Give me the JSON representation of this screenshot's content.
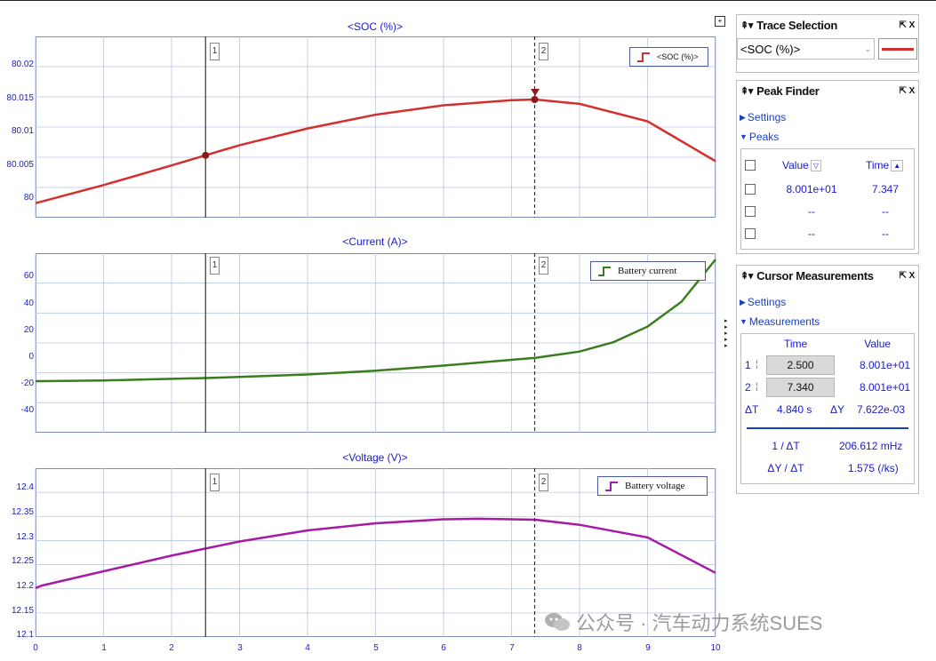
{
  "plots": [
    {
      "id": "soc",
      "title": "<SOC (%)>",
      "yticks": [
        "80.02",
        "80.015",
        "80.01",
        "80.005",
        "80"
      ],
      "legend": "<SOC (%)>",
      "color": "#d32f2f"
    },
    {
      "id": "current",
      "title": "<Current (A)>",
      "yticks": [
        "60",
        "40",
        "20",
        "0",
        "-20",
        "-40"
      ],
      "legend": "Battery current",
      "color": "#3a7d1f"
    },
    {
      "id": "voltage",
      "title": "<Voltage (V)>",
      "yticks": [
        "12.4",
        "12.35",
        "12.3",
        "12.25",
        "12.2",
        "12.15",
        "12.1"
      ],
      "legend": "Battery voltage",
      "color": "#a61aa6"
    }
  ],
  "xticks": [
    "0",
    "1",
    "2",
    "3",
    "4",
    "5",
    "6",
    "7",
    "8",
    "9",
    "10"
  ],
  "cursors": {
    "c1_label": "1",
    "c2_label": "2",
    "c1_time": 2.5,
    "c2_time": 7.34
  },
  "chart_data": [
    {
      "type": "line",
      "title": "<SOC (%)>",
      "xlim": [
        0,
        10
      ],
      "ylim": [
        79.998,
        80.023
      ],
      "series": [
        {
          "name": "<SOC (%)>",
          "x": [
            0,
            1,
            2,
            2.5,
            3,
            4,
            5,
            6,
            7,
            7.35,
            8,
            9,
            10
          ],
          "y": [
            80.0,
            80.0025,
            80.0052,
            80.0066,
            80.008,
            80.0103,
            80.0122,
            80.0135,
            80.0142,
            80.0143,
            80.0137,
            80.0113,
            80.0058
          ]
        }
      ]
    },
    {
      "type": "line",
      "title": "<Current (A)>",
      "xlim": [
        0,
        10
      ],
      "ylim": [
        -48,
        67
      ],
      "series": [
        {
          "name": "Battery current",
          "x": [
            0,
            0.1,
            1,
            2,
            2.5,
            3,
            4,
            5,
            6,
            7,
            7.35,
            8,
            8.5,
            9,
            9.5,
            10
          ],
          "y": [
            -15,
            -15,
            -14.5,
            -13.5,
            -13,
            -12.3,
            -10.7,
            -8.3,
            -5,
            -1.3,
            0,
            4,
            10,
            20,
            36,
            63
          ]
        }
      ]
    },
    {
      "type": "line",
      "title": "<Voltage (V)>",
      "xlim": [
        0,
        10
      ],
      "ylim": [
        12.098,
        12.432
      ],
      "series": [
        {
          "name": "Battery voltage",
          "x": [
            0,
            0.1,
            1,
            2,
            2.5,
            3,
            4,
            5,
            6,
            6.5,
            7,
            7.35,
            8,
            9,
            10
          ],
          "y": [
            12.195,
            12.2,
            12.228,
            12.259,
            12.273,
            12.287,
            12.309,
            12.323,
            12.331,
            12.332,
            12.331,
            12.33,
            12.32,
            12.295,
            12.225
          ]
        }
      ]
    }
  ],
  "trace_selection": {
    "title": "Trace Selection",
    "selected": "<SOC (%)>",
    "line_color": "#d32f2f"
  },
  "peak_finder": {
    "title": "Peak Finder",
    "settings_label": "Settings",
    "peaks_label": "Peaks",
    "col_value": "Value",
    "col_time": "Time",
    "rows": [
      {
        "value": "8.001e+01",
        "time": "7.347"
      },
      {
        "value": "--",
        "time": "--"
      },
      {
        "value": "--",
        "time": "--"
      }
    ]
  },
  "cursor_measurements": {
    "title": "Cursor Measurements",
    "settings_label": "Settings",
    "measurements_label": "Measurements",
    "col_time": "Time",
    "col_value": "Value",
    "row1": {
      "idx": "1",
      "time": "2.500",
      "value": "8.001e+01"
    },
    "row2": {
      "idx": "2",
      "time": "7.340",
      "value": "8.001e+01"
    },
    "delta": {
      "dt_label": "ΔT",
      "dt": "4.840 s",
      "dy_label": "ΔY",
      "dy": "7.622e-03"
    },
    "inv_dt_label": "1 / ΔT",
    "inv_dt": "206.612 mHz",
    "dy_dt_label": "ΔY / ΔT",
    "dy_dt": "1.575 (/ks)"
  },
  "watermark": "公众号 · 汽车动力系统SUES"
}
